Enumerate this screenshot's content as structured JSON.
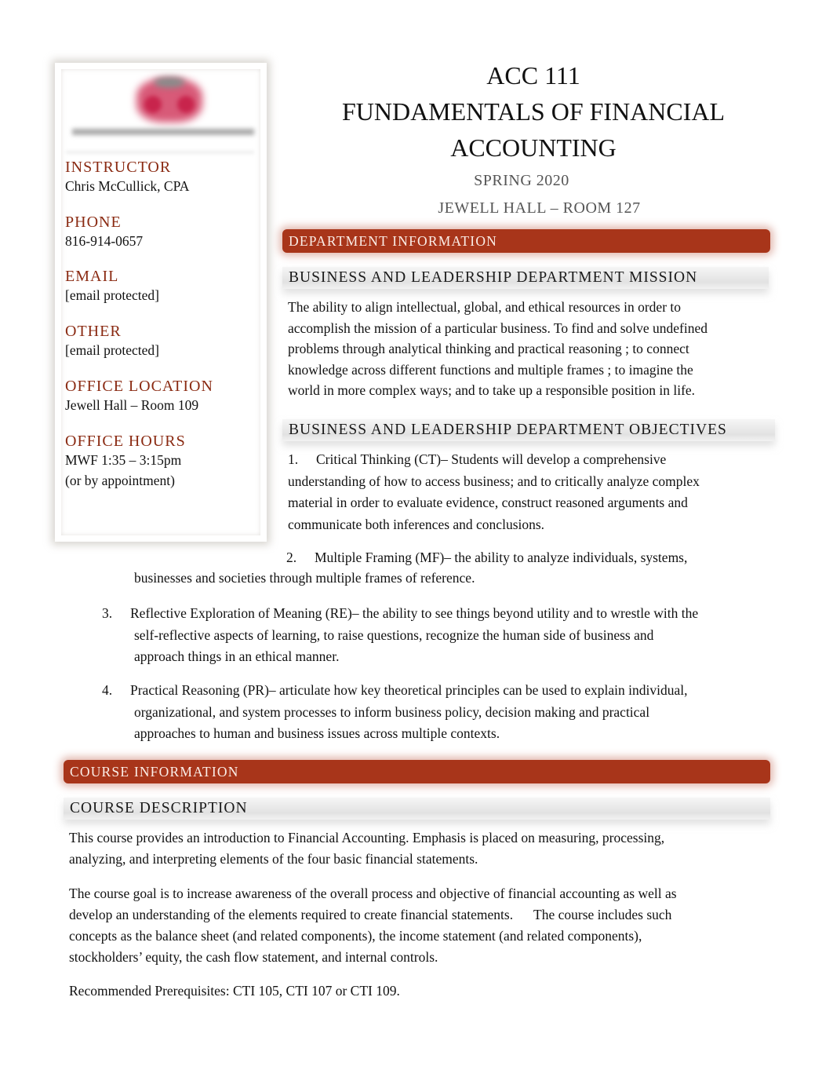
{
  "sidebar": {
    "logo": "university-logo",
    "fields": [
      {
        "label": "INSTRUCTOR",
        "value": "Chris McCullick, CPA"
      },
      {
        "label": "PHONE",
        "value": "816-914-0657"
      },
      {
        "label": "EMAIL",
        "value": "[email protected]"
      },
      {
        "label": "OTHER",
        "value": "[email protected]"
      },
      {
        "label": "OFFICE LOCATION",
        "value": "Jewell Hall – Room 109"
      },
      {
        "label": "OFFICE HOURS",
        "value": "MWF 1:35 – 3:15pm",
        "value2": "(or by appointment)"
      }
    ]
  },
  "header": {
    "course_code": "ACC 111",
    "course_title_line1": "FUNDAMENTALS OF FINANCIAL",
    "course_title_line2": "ACCOUNTING",
    "term": "SPRING 2020",
    "location": "JEWELL HALL – ROOM 127"
  },
  "department": {
    "band": "DEPARTMENT INFORMATION",
    "mission_heading": "BUSINESS AND LEADERSHIP DEPARTMENT MISSION",
    "mission_lines": [
      "The ability to align intellectual, global, and ethical resources in order to",
      "accomplish the mission of a particular business. To  find and solve  undefined",
      "problems through  analytical thinking  and practical reasoning ; to connect",
      "knowledge  across different functions and  multiple frames ; to imagine the",
      "world in more complex ways; and to take up  a responsible position   in life."
    ],
    "objectives_heading": "BUSINESS AND LEADERSHIP DEPARTMENT OBJECTIVES",
    "objectives": [
      {
        "num": "1.",
        "lines": [
          "Critical Thinking (CT)– Students will develop a comprehensive",
          "understanding of how to access business; and to critically analyze complex",
          "material in order to evaluate evidence, construct reasoned arguments and",
          "communicate both inferences and conclusions."
        ]
      },
      {
        "num": "2.",
        "lines": [
          "Multiple Framing (MF)– the ability to analyze individuals, systems,",
          "businesses and societies through multiple frames of reference."
        ]
      },
      {
        "num": "3.",
        "lines": [
          "Reflective Exploration of Meaning (RE)– the ability to see things beyond utility and to wrestle with the",
          "self-reflective aspects of learning, to raise questions, recognize the human side of business and",
          "approach things in an ethical manner."
        ]
      },
      {
        "num": "4.",
        "lines": [
          "Practical Reasoning (PR)– articulate how key theoretical principles can be used to explain individual,",
          "organizational, and system processes to inform business policy, decision making and practical",
          "approaches to human and business issues across multiple contexts."
        ]
      }
    ]
  },
  "course": {
    "band": "COURSE INFORMATION",
    "description_heading": "COURSE DESCRIPTION",
    "para1": [
      "This course provides an introduction to Financial Accounting. Emphasis is placed on measuring, processing,",
      "analyzing, and interpreting elements of the four basic financial statements."
    ],
    "para2": [
      "The course goal is to increase awareness of the overall process and objective of financial accounting as well as",
      "develop an understanding of the elements required to create financial statements.      The course includes such",
      "concepts as the balance sheet (and related components), the income statement (and related components),",
      "stockholders’ equity, the cash flow statement, and internal controls."
    ],
    "prereq": "Recommended Prerequisites: CTI 105, CTI 107 or CTI 109."
  },
  "colors": {
    "accent": "#a8351a",
    "label": "#8a2a12"
  }
}
